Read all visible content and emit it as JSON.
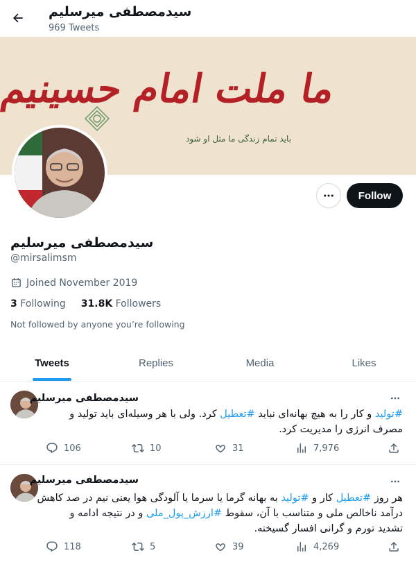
{
  "header": {
    "title": "سیدمصطفی میرسلیم",
    "tweet_count": "969 Tweets"
  },
  "banner": {
    "calligraphy": "ما ملت امام حسینیم",
    "subtitle": "باید تمام زندگی ما مثل او شود"
  },
  "profile": {
    "display_name": "سیدمصطفی میرسلیم",
    "handle": "@mirsalimsm",
    "joined": "Joined November 2019",
    "following_count": "3",
    "following_label": "Following",
    "followers_count": "31.8K",
    "followers_label": "Followers",
    "not_followed": "Not followed by anyone you’re following",
    "follow_label": "Follow"
  },
  "tabs": [
    {
      "label": "Tweets",
      "active": true
    },
    {
      "label": "Replies",
      "active": false
    },
    {
      "label": "Media",
      "active": false
    },
    {
      "label": "Likes",
      "active": false
    }
  ],
  "tweets": [
    {
      "author": "سیدمصطفی میرسلیم",
      "line1_ht1": "#تولید",
      "line1_a": " و کار را به هیچ بهانه‌ای نباید ",
      "line1_ht2": "#تعطیل",
      "line1_b": " کرد. ولی با هر وسیله‌ای باید تولید و",
      "line2": "مصرف انرژی را مدیریت کرد.",
      "replies": "106",
      "retweets": "10",
      "likes": "31",
      "views": "7,976"
    },
    {
      "author": "سیدمصطفی میرسلیم",
      "l1_a": "هر روز ",
      "l1_ht1": "#تعطیل",
      "l1_b": " کار و ",
      "l1_ht2": "#تولید",
      "l1_c": " به بهانه گرما یا سرما یا آلودگی هوا یعنی نیم در صد کاهش",
      "l2_a": "درآمد ناخالص ملی و متناسب با آن، سقوط ",
      "l2_ht": "#ارزش_پول_ملی",
      "l2_b": " و در نتیجه ادامه و",
      "l3": "تشدید تورم و گرانی افسار گسیخته.",
      "replies": "118",
      "retweets": "5",
      "likes": "39",
      "views": "4,269"
    }
  ],
  "colors": {
    "accent": "#1d9bf0",
    "text": "#0f1419",
    "muted": "#536471",
    "banner_red": "#b32126"
  },
  "icons": {
    "back": "arrow-left-icon",
    "more": "ellipsis-icon",
    "calendar": "calendar-icon",
    "reply": "reply-icon",
    "retweet": "retweet-icon",
    "like": "heart-icon",
    "views": "views-icon",
    "share": "share-icon"
  }
}
